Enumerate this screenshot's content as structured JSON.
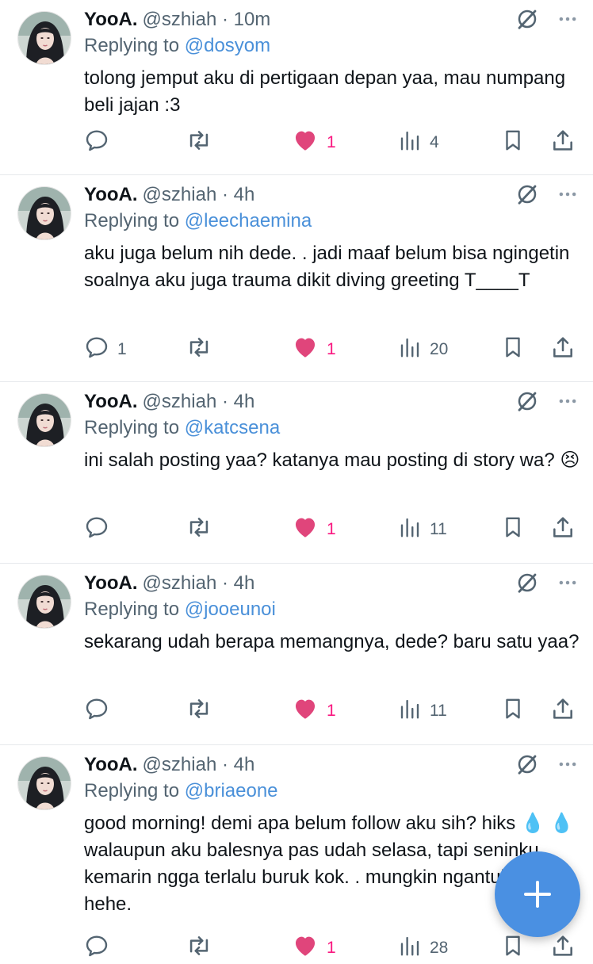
{
  "tweets": [
    {
      "name": "YooA.",
      "handle": "@szhiah · 10m",
      "reply_prefix": "Replying to",
      "reply_to": "@dosyom",
      "text": "tolong jemput aku di pertigaan depan yaa, mau numpang beli jajan :3",
      "replies": "",
      "likes": "1",
      "views": "4"
    },
    {
      "name": "YooA.",
      "handle": "@szhiah · 4h",
      "reply_prefix": "Replying to",
      "reply_to": "@leechaemina",
      "text": "aku juga belum nih dede. . jadi maaf belum bisa ngingetin soalnya aku juga trauma dikit diving greeting T____T",
      "replies": "1",
      "likes": "1",
      "views": "20"
    },
    {
      "name": "YooA.",
      "handle": "@szhiah · 4h",
      "reply_prefix": "Replying to",
      "reply_to": "@katcsena",
      "text": "ini salah posting yaa? katanya mau posting di story wa? 😣",
      "replies": "",
      "likes": "1",
      "views": "11"
    },
    {
      "name": "YooA.",
      "handle": "@szhiah · 4h",
      "reply_prefix": "Replying to",
      "reply_to": "@jooeunoi",
      "text": "sekarang udah berapa memangnya, dede? baru satu yaa?",
      "replies": "",
      "likes": "1",
      "views": "11"
    },
    {
      "name": "YooA.",
      "handle": "@szhiah · 4h",
      "reply_prefix": "Replying to",
      "reply_to": "@briaeone",
      "text": "good morning! demi apa belum follow aku sih? hiks 💧 💧 walaupun aku balesnya pas udah selasa, tapi seninku kemarin ngga terlalu buruk kok. . mungkin ngantuk aja sih hehe.",
      "replies": "",
      "likes": "1",
      "views": "28"
    }
  ],
  "icons": {
    "reply": "speech-bubble-icon",
    "retweet": "retweet-icon",
    "like": "heart-icon",
    "views": "bar-chart-icon",
    "bookmark": "bookmark-icon",
    "share": "share-icon",
    "fab": "plus-icon"
  },
  "colors": {
    "like": "#f91880",
    "link": "#4a90d9",
    "muted": "#536471",
    "fab": "#4a90e2"
  }
}
